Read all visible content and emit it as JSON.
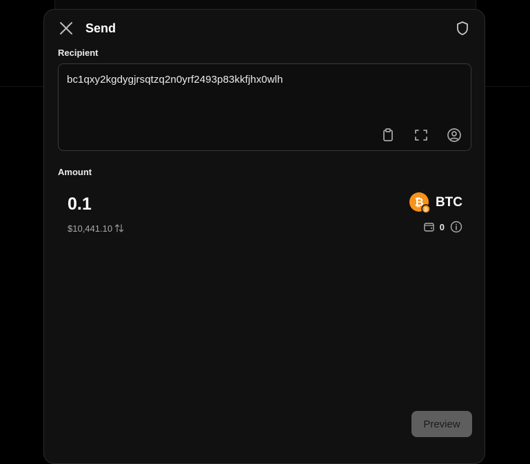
{
  "header": {
    "title": "Send",
    "close_icon": "close-icon",
    "shield_icon": "shield-icon"
  },
  "recipient": {
    "label": "Recipient",
    "address": "bc1qxy2kgdygjrsqtzq2n0yrf2493p83kkfjhx0wlh",
    "icons": [
      "clipboard-icon",
      "scan-icon",
      "contact-icon"
    ]
  },
  "amount": {
    "label": "Amount",
    "value": "0.1",
    "fiat_value": "$10,441.10",
    "token": "BTC",
    "balance": "0",
    "token_color": "#F7931A"
  },
  "footer": {
    "preview_label": "Preview"
  },
  "colors": {
    "modal_bg": "#111111",
    "border": "#3a3a3a",
    "button_disabled": "#5e5e5e",
    "bitcoin_orange": "#F7931A"
  }
}
